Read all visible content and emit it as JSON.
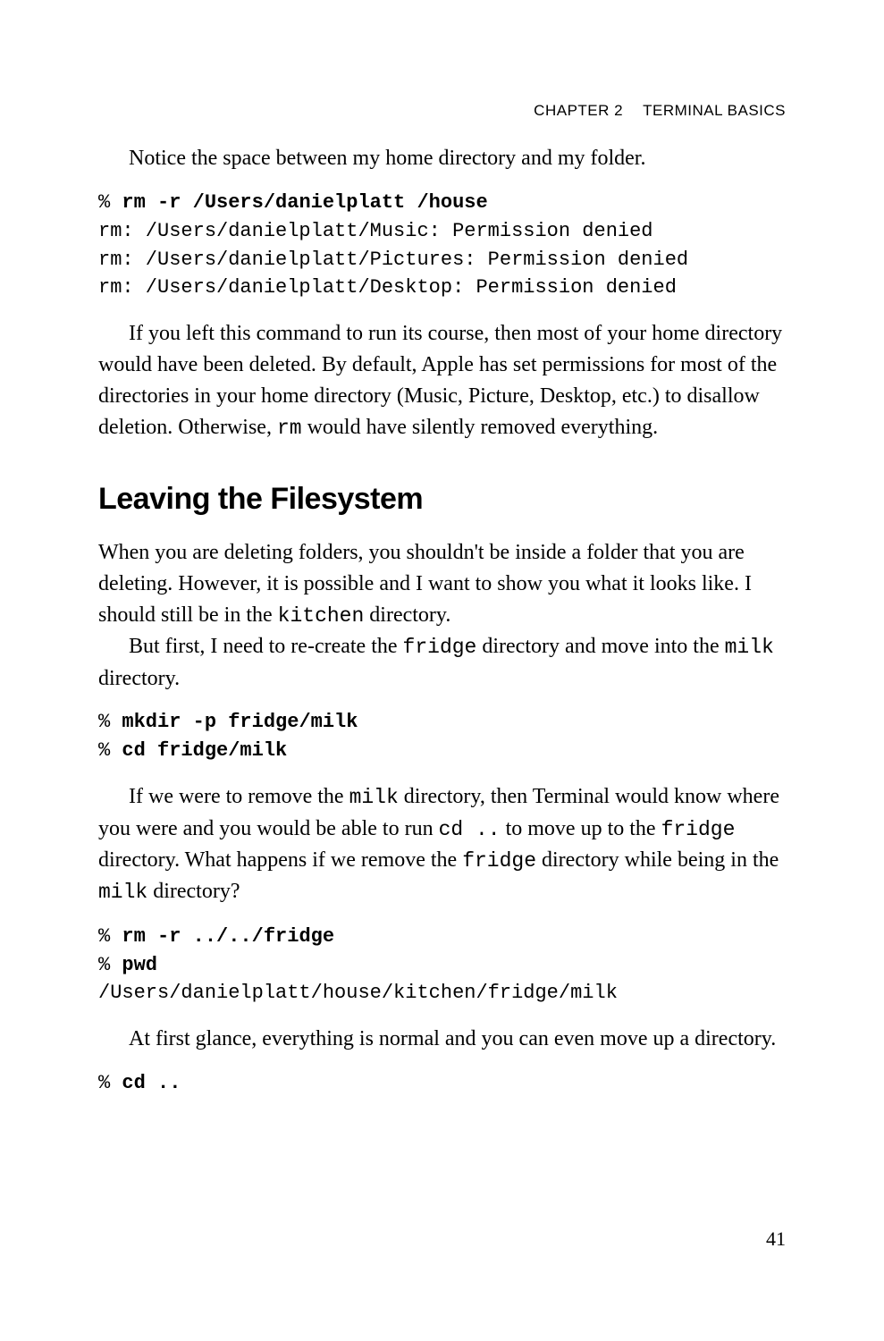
{
  "header": {
    "chapter": "CHAPTER 2",
    "title": "TERMINAL BASICS"
  },
  "p1": "Notice the space between my home directory and my folder.",
  "code1": {
    "prompt": "%",
    "cmd": "rm -r /Users/danielplatt /house",
    "out1": "rm: /Users/danielplatt/Music: Permission denied",
    "out2": "rm: /Users/danielplatt/Pictures: Permission denied",
    "out3": "rm: /Users/danielplatt/Desktop: Permission denied"
  },
  "p2a": "If you left this command to run its course, then most of your home directory would have been deleted. By default, Apple has set permissions for most of the directories in your home directory (Music, Picture, Desktop, etc.) to disallow deletion. Otherwise, ",
  "p2_mono": "rm",
  "p2b": " would have silently removed everything.",
  "section_heading": "Leaving the Filesystem",
  "p3a": "When you are deleting folders, you shouldn't be inside a folder that you are deleting. However, it is possible and I want to show you what it looks like. I should still be in the ",
  "p3_mono": "kitchen",
  "p3b": " directory.",
  "p4a": "But first, I need to re-create the ",
  "p4_mono1": "fridge",
  "p4b": " directory and move into the ",
  "p4_mono2": "milk",
  "p4c": " directory.",
  "code2": {
    "prompt1": "%",
    "cmd1": "mkdir -p fridge/milk",
    "prompt2": "%",
    "cmd2": "cd fridge/milk"
  },
  "p5a": "If we were to remove the ",
  "p5_mono1": "milk",
  "p5b": " directory, then Terminal would know where you were and you would be able to run ",
  "p5_mono2": "cd ..",
  "p5c": " to move up to the ",
  "p5_mono3": "fridge",
  "p5d": " directory. What happens if we remove the ",
  "p5_mono4": "fridge",
  "p5e": " directory while being in the ",
  "p5_mono5": "milk",
  "p5f": " directory?",
  "code3": {
    "prompt1": "%",
    "cmd1": "rm -r ../../fridge",
    "prompt2": "%",
    "cmd2": "pwd",
    "out": "/Users/danielplatt/house/kitchen/fridge/milk"
  },
  "p6": "At first glance, everything is normal and you can even move up a directory.",
  "code4": {
    "prompt": "%",
    "cmd": "cd .."
  },
  "page_number": "41"
}
